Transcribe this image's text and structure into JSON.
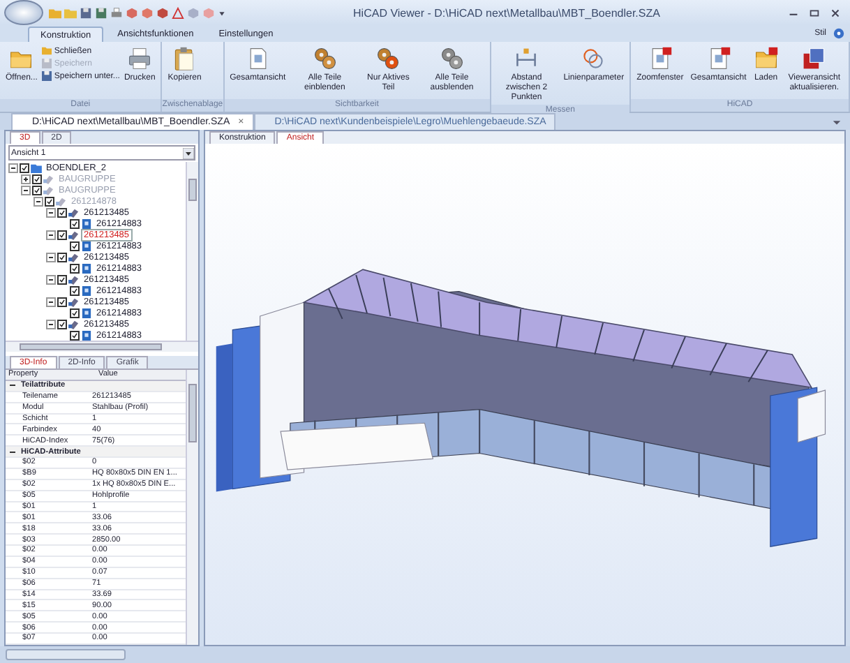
{
  "window": {
    "title": "HiCAD Viewer - D:\\HiCAD next\\Metallbau\\MBT_Boendler.SZA"
  },
  "ribbon": {
    "tabs": [
      {
        "label": "Konstruktion",
        "selected": true
      },
      {
        "label": "Ansichtsfunktionen",
        "selected": false
      },
      {
        "label": "Einstellungen",
        "selected": false
      }
    ],
    "style_menu": "Stil",
    "groups": [
      {
        "label": "Datei",
        "items": [
          {
            "kind": "large",
            "label": "Öffnen..."
          },
          {
            "kind": "stack",
            "items": [
              {
                "label": "Schließen",
                "disabled": false
              },
              {
                "label": "Speichern",
                "disabled": true
              },
              {
                "label": "Speichern unter...",
                "disabled": false
              }
            ]
          },
          {
            "kind": "large",
            "label": "Drucken"
          }
        ]
      },
      {
        "label": "Zwischenablage",
        "items": [
          {
            "kind": "large",
            "label": "Kopieren"
          }
        ]
      },
      {
        "label": "Sichtbarkeit",
        "items": [
          {
            "kind": "large",
            "label": "Gesamtansicht"
          },
          {
            "kind": "large",
            "label": "Alle Teile einblenden"
          },
          {
            "kind": "large",
            "label": "Nur Aktives Teil"
          },
          {
            "kind": "large",
            "label": "Alle Teile ausblenden"
          }
        ]
      },
      {
        "label": "Messen",
        "items": [
          {
            "kind": "large",
            "label": "Abstand zwischen 2 Punkten"
          },
          {
            "kind": "large",
            "label": "Linienparameter"
          }
        ]
      },
      {
        "label": "HiCAD",
        "items": [
          {
            "kind": "large",
            "label": "Zoomfenster"
          },
          {
            "kind": "large",
            "label": "Gesamtansicht"
          },
          {
            "kind": "large",
            "label": "Laden"
          },
          {
            "kind": "large",
            "label": "Vieweransicht aktualisieren."
          }
        ]
      }
    ]
  },
  "doc_tabs": [
    {
      "label": "D:\\HiCAD next\\Metallbau\\MBT_Boendler.SZA",
      "selected": true,
      "close": "×"
    },
    {
      "label": "D:\\HiCAD next\\Kundenbeispiele\\Legro\\Muehlengebaeude.SZA",
      "selected": false
    }
  ],
  "left_panel": {
    "tabs": [
      {
        "label": "3D",
        "selected": true
      },
      {
        "label": "2D",
        "selected": false
      }
    ],
    "view_select": "Ansicht 1",
    "tree": [
      {
        "label": "BOENDLER_2",
        "kind": "root",
        "checked": true,
        "expanded": true,
        "dimmed": false,
        "selected": false,
        "children": [
          {
            "label": "BAUGRUPPE",
            "kind": "assembly",
            "checked": true,
            "expanded": false,
            "dimmed": true,
            "selected": false
          },
          {
            "label": "BAUGRUPPE",
            "kind": "assembly",
            "checked": true,
            "expanded": true,
            "dimmed": true,
            "selected": false,
            "children": [
              {
                "label": "261214878",
                "kind": "assembly",
                "checked": true,
                "expanded": true,
                "dimmed": true,
                "selected": false,
                "children": [
                  {
                    "label": "261213485",
                    "kind": "assembly",
                    "checked": true,
                    "expanded": true,
                    "dimmed": false,
                    "selected": false,
                    "children": [
                      {
                        "label": "261214883",
                        "kind": "part",
                        "checked": true,
                        "dimmed": false,
                        "selected": false
                      }
                    ]
                  },
                  {
                    "label": "261213485",
                    "kind": "assembly",
                    "checked": true,
                    "expanded": true,
                    "dimmed": false,
                    "selected": true,
                    "children": [
                      {
                        "label": "261214883",
                        "kind": "part",
                        "checked": true,
                        "dimmed": false,
                        "selected": false
                      }
                    ]
                  },
                  {
                    "label": "261213485",
                    "kind": "assembly",
                    "checked": true,
                    "expanded": true,
                    "dimmed": false,
                    "selected": false,
                    "children": [
                      {
                        "label": "261214883",
                        "kind": "part",
                        "checked": true,
                        "dimmed": false,
                        "selected": false
                      }
                    ]
                  },
                  {
                    "label": "261213485",
                    "kind": "assembly",
                    "checked": true,
                    "expanded": true,
                    "dimmed": false,
                    "selected": false,
                    "children": [
                      {
                        "label": "261214883",
                        "kind": "part",
                        "checked": true,
                        "dimmed": false,
                        "selected": false
                      }
                    ]
                  },
                  {
                    "label": "261213485",
                    "kind": "assembly",
                    "checked": true,
                    "expanded": true,
                    "dimmed": false,
                    "selected": false,
                    "children": [
                      {
                        "label": "261214883",
                        "kind": "part",
                        "checked": true,
                        "dimmed": false,
                        "selected": false
                      }
                    ]
                  },
                  {
                    "label": "261213485",
                    "kind": "assembly",
                    "checked": true,
                    "expanded": true,
                    "dimmed": false,
                    "selected": false,
                    "children": [
                      {
                        "label": "261214883",
                        "kind": "part",
                        "checked": true,
                        "dimmed": false,
                        "selected": false
                      }
                    ]
                  }
                ]
              }
            ]
          }
        ]
      }
    ],
    "info_tabs": [
      {
        "label": "3D-Info",
        "selected": true
      },
      {
        "label": "2D-Info",
        "selected": false
      },
      {
        "label": "Grafik",
        "selected": false
      }
    ],
    "properties": {
      "columns": [
        "Property",
        "Value"
      ],
      "groups": [
        {
          "label": "Teilattribute",
          "expanded": true,
          "rows": [
            [
              "Teilename",
              "261213485"
            ],
            [
              "Modul",
              "Stahlbau (Profil)"
            ],
            [
              "Schicht",
              "1"
            ],
            [
              "Farbindex",
              "40"
            ],
            [
              "HiCAD-Index",
              "75(76)"
            ]
          ]
        },
        {
          "label": "HiCAD-Attribute",
          "expanded": true,
          "rows": [
            [
              "$02",
              "0"
            ],
            [
              "$B9",
              "HQ 80x80x5 DIN EN 1..."
            ],
            [
              "$02",
              "1x HQ 80x80x5 DIN E..."
            ],
            [
              "$05",
              "Hohlprofile"
            ],
            [
              "$01",
              "1"
            ],
            [
              "$01",
              "33.06"
            ],
            [
              "$18",
              "33.06"
            ],
            [
              "$03",
              "2850.00"
            ],
            [
              "$02",
              "0.00"
            ],
            [
              "$04",
              "0.00"
            ],
            [
              "$10",
              "0.07"
            ],
            [
              "$06",
              "71"
            ],
            [
              "$14",
              "33.69"
            ],
            [
              "$15",
              "90.00"
            ],
            [
              "$05",
              "0.00"
            ],
            [
              "$06",
              "0.00"
            ],
            [
              "$07",
              "0.00"
            ]
          ]
        }
      ]
    }
  },
  "view_tabs": [
    {
      "label": "Konstruktion",
      "selected": false
    },
    {
      "label": "Ansicht",
      "selected": true
    }
  ]
}
